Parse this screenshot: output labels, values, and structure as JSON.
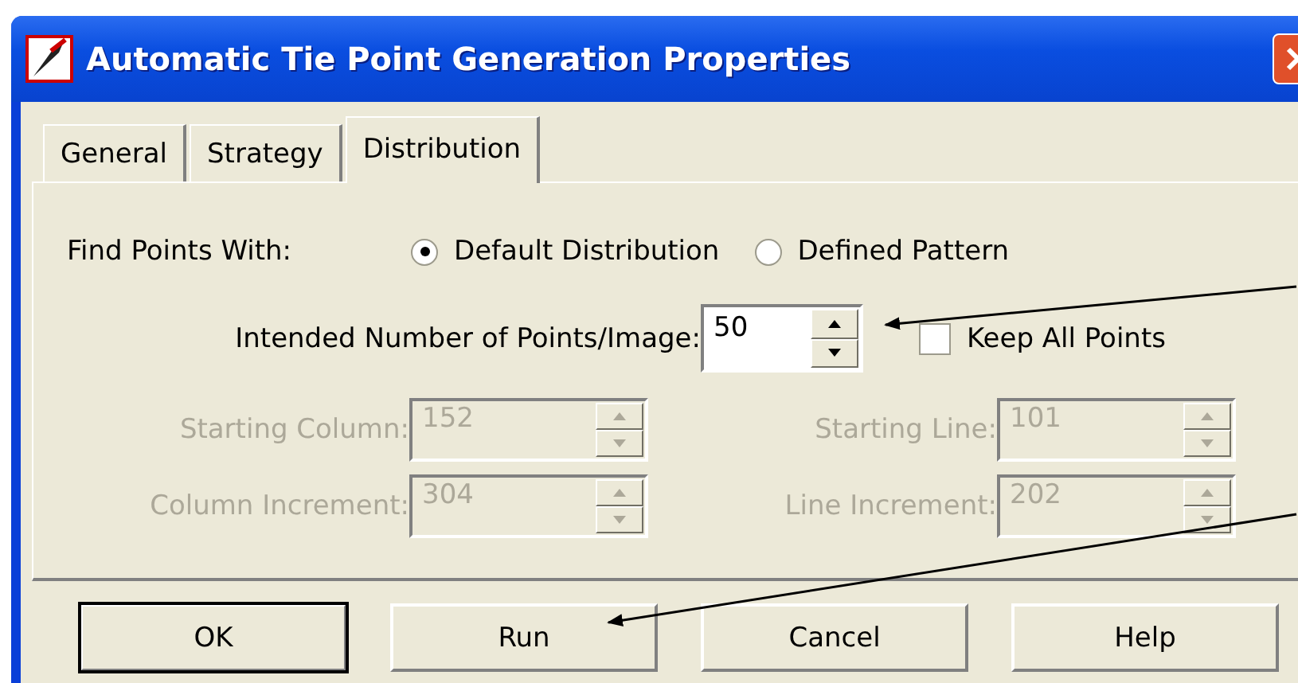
{
  "window": {
    "title": "Automatic Tie Point Generation Properties"
  },
  "tabs": [
    {
      "label": "General",
      "selected": false
    },
    {
      "label": "Strategy",
      "selected": false
    },
    {
      "label": "Distribution",
      "selected": true
    }
  ],
  "find_points": {
    "label": "Find Points With:",
    "options": [
      {
        "label": "Default Distribution",
        "selected": true
      },
      {
        "label": "Defined Pattern",
        "selected": false
      }
    ]
  },
  "intended_points": {
    "label": "Intended Number of Points/Image:",
    "value": "50",
    "keep_all_points": {
      "label": "Keep All Points",
      "checked": false
    }
  },
  "grid_fields": [
    {
      "label": "Starting Column:",
      "value": "152",
      "disabled": true
    },
    {
      "label": "Starting Line:",
      "value": "101",
      "disabled": true
    },
    {
      "label": "Column Increment:",
      "value": "304",
      "disabled": true
    },
    {
      "label": "Line Increment:",
      "value": "202",
      "disabled": true
    }
  ],
  "buttons": [
    {
      "label": "OK",
      "default": true
    },
    {
      "label": "Run",
      "default": false
    },
    {
      "label": "Cancel",
      "default": false
    },
    {
      "label": "Help",
      "default": false
    }
  ]
}
